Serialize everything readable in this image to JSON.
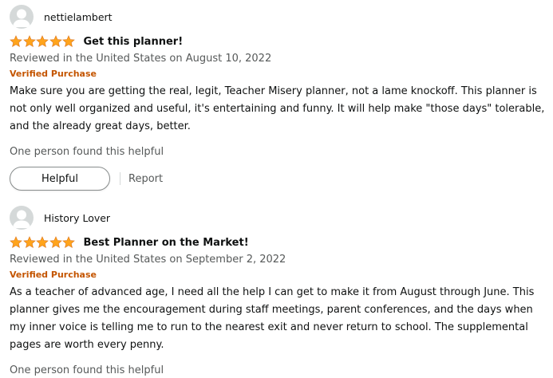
{
  "colors": {
    "star": "#ffa41c",
    "verified": "#c45500",
    "secondary_text": "#565959",
    "avatar_bg": "#d5d9d9"
  },
  "reviews": [
    {
      "author": "nettielambert",
      "rating": 5,
      "title": "Get this planner!",
      "date": "Reviewed in the United States on August 10, 2022",
      "verified": "Verified Purchase",
      "body": "Make sure you are getting the real, legit, Teacher Misery planner, not a lame knockoff. This planner is not only well organized and useful, it's entertaining and funny. It will help make \"those days\" tolerable, and the already great days, better.",
      "helpful_count": "One person found this helpful",
      "helpful_button": "Helpful",
      "report_link": "Report"
    },
    {
      "author": "History Lover",
      "rating": 5,
      "title": "Best Planner on the Market!",
      "date": "Reviewed in the United States on September 2, 2022",
      "verified": "Verified Purchase",
      "body": "As a teacher of advanced age, I need all the help I can get to make it from August through June. This planner gives me the encouragement during staff meetings, parent conferences, and the days when my inner voice is telling me to run to the nearest exit and never return to school. The supplemental pages are worth every penny.",
      "helpful_count": "One person found this helpful"
    }
  ]
}
